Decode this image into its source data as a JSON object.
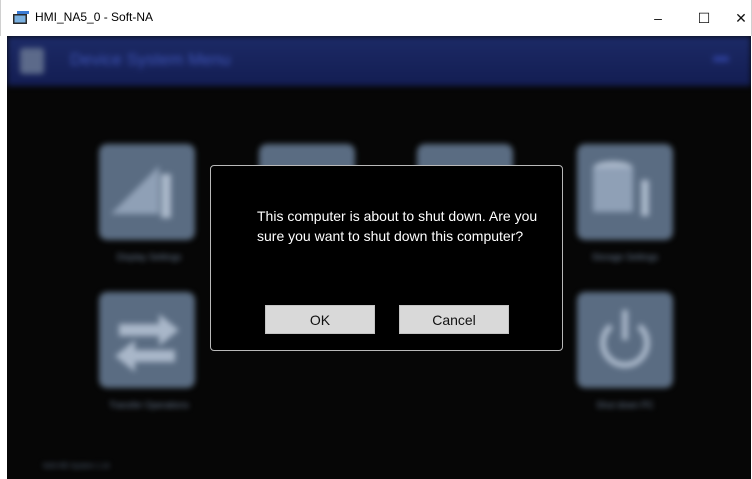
{
  "window": {
    "title": "HMI_NA5_0 - Soft-NA",
    "minimize_glyph": "–",
    "maximize_glyph": "☐",
    "close_glyph": "✕"
  },
  "background": {
    "menu_title": "Device System Menu",
    "tiles": [
      {
        "label": "Display Settings",
        "icon": "display-settings-icon"
      },
      {
        "label": "",
        "icon": "menu-tile-icon"
      },
      {
        "label": "",
        "icon": "menu-tile-icon"
      },
      {
        "label": "Storage Settings",
        "icon": "storage-settings-icon"
      },
      {
        "label": "Transfer Operations",
        "icon": "transfer-icon"
      },
      {
        "label": "Shut down PC",
        "icon": "power-icon"
      }
    ],
    "footer": "NA5-RE System 1.14"
  },
  "dialog": {
    "message": "This computer is about to shut down. Are you sure you want to shut down this computer?",
    "ok_label": "OK",
    "cancel_label": "Cancel"
  },
  "colors": {
    "menubar": "#1c2a66",
    "tile": "#5a6c82",
    "dialog_bg": "#000000",
    "button_bg": "#d9d9d9"
  }
}
